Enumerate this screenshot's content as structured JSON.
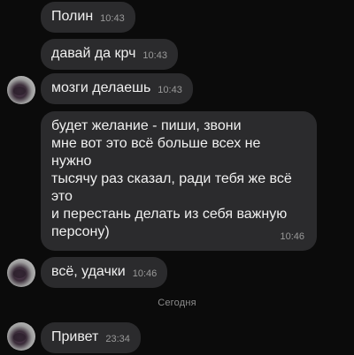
{
  "messages": [
    {
      "text": "Полин",
      "time": "10:43"
    },
    {
      "text": "давай да крч",
      "time": "10:43"
    },
    {
      "text": "мозги делаешь",
      "time": "10:43"
    },
    {
      "text": "будет желание - пиши, звони\nмне вот это всё больше всех не\nнужно\nтысячу раз сказал, ради тебя же всё\nэто\nи перестань делать из себя важную\nперсону)",
      "time": "10:46"
    },
    {
      "text": "всё, удачки",
      "time": "10:46"
    },
    {
      "text": "Привет",
      "time": "23:34"
    }
  ],
  "date_divider": "Сегодня"
}
